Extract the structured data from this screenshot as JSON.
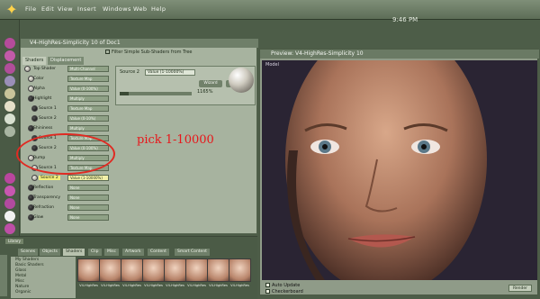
{
  "menubar": {
    "items": [
      "File",
      "Edit",
      "View",
      "Insert",
      "Windows",
      "Web",
      "Help"
    ],
    "clock": "9:46 PM"
  },
  "material_room": {
    "title": "V4-HighRes-Simplicity 10 of Doc1",
    "tabs": [
      "Shaders",
      "Displacement"
    ],
    "filter_label": "Filter Simple Sub-Shaders from Tree",
    "tree": [
      {
        "label": "Top Shader",
        "value": "Multi-Channel",
        "node": "light"
      },
      {
        "label": "Color",
        "value": "Texture Map",
        "node": "light"
      },
      {
        "label": "Alpha",
        "value": "Value (0-100%)",
        "node": "light"
      },
      {
        "label": "Highlight",
        "value": "Multiply",
        "node": "dark"
      },
      {
        "label": "Source 1",
        "value": "Texture Map",
        "node": "dark"
      },
      {
        "label": "Source 2",
        "value": "Value (0-10%)",
        "node": "dark"
      },
      {
        "label": "Shininess",
        "value": "Multiply",
        "node": "dark"
      },
      {
        "label": "Source 1",
        "value": "Texture Map",
        "node": "dark"
      },
      {
        "label": "Source 2",
        "value": "Value (0-100%)",
        "node": "dark"
      },
      {
        "label": "Bump",
        "value": "Multiply",
        "node": "light"
      },
      {
        "label": "Source 1",
        "value": "Texture Map",
        "node": "light"
      },
      {
        "label": "Source 2",
        "value": "Value (1-10000%)",
        "node": "light",
        "selected": true
      },
      {
        "label": "Reflection",
        "value": "None",
        "node": "dark"
      },
      {
        "label": "Transparency",
        "value": "None",
        "node": "dark"
      },
      {
        "label": "Refraction",
        "value": "None",
        "node": "dark"
      },
      {
        "label": "Glow",
        "value": "None",
        "node": "dark"
      }
    ],
    "props": {
      "source_label": "Source 2",
      "value_label": "Value (1-10000%)",
      "wizard_label": "Wizard",
      "parent_label": "Parent",
      "slider_readout": "1165%",
      "slider_level": 0.12
    }
  },
  "annotation": {
    "text": "pick 1-10000"
  },
  "preview": {
    "title": "Preview: V4-HighRes-Simplicity 10",
    "view_label": "Model",
    "auto_update_label": "Auto Update",
    "checkerboard_label": "Checkerboard",
    "render_label": "Render"
  },
  "library": {
    "header": "Library",
    "tabs": [
      "Scenes",
      "Objects",
      "Shaders",
      "Clip",
      "Misc",
      "Artwork",
      "Content",
      "Smart Content"
    ],
    "active_tab": 2,
    "categories": [
      "My Shaders",
      "Basic Shaders",
      "Glass",
      "Metal",
      "Misc",
      "Nature",
      "Organic"
    ],
    "thumbnails": [
      "V4-HighRes",
      "V4-HighRes",
      "V4-HighRes",
      "V4-HighRes",
      "V4-HighRes",
      "V4-HighRes",
      "V4-HighRes",
      "V4-HighRes"
    ]
  },
  "colors": {
    "annotation_red": "#e02a22",
    "selection_yellow": "#f3ef7a",
    "panel_green": "#a7b39f"
  }
}
